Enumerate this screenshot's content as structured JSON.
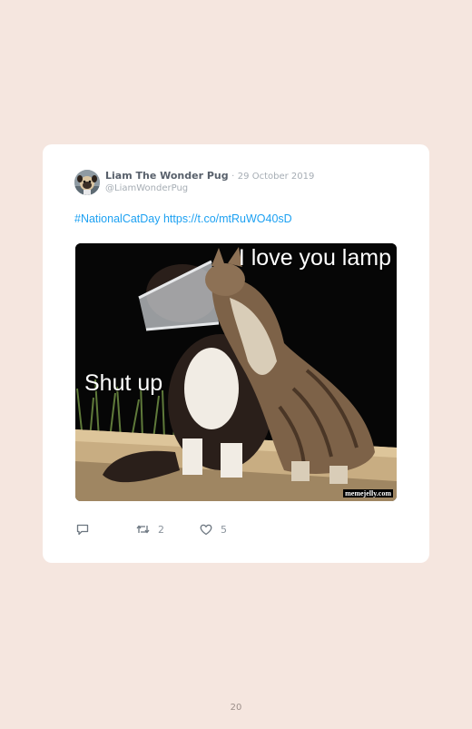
{
  "tweet": {
    "author_name": "Liam The Wonder Pug",
    "separator": "·",
    "date": "29 October 2019",
    "handle": "@LiamWonderPug",
    "hashtag": "#NationalCatDay",
    "link": "https://t.co/mtRuWO40sD",
    "media": {
      "caption_top": "I love you lamp",
      "caption_left": "Shut up",
      "watermark": "memejelly.com"
    },
    "actions": {
      "reply_icon": "comment-icon",
      "retweet_icon": "retweet-icon",
      "retweet_count": "2",
      "like_icon": "heart-icon",
      "like_count": "5"
    }
  },
  "page": {
    "number": "20"
  },
  "colors": {
    "background": "#f5e6df",
    "card": "#ffffff",
    "link": "#1da1f2",
    "muted": "#a6adb4"
  }
}
